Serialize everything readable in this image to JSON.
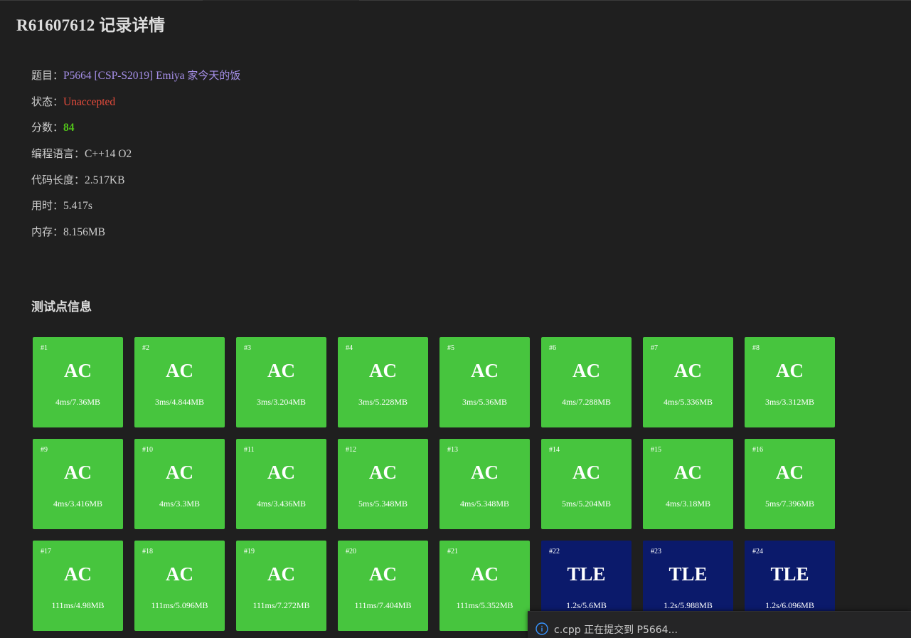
{
  "record": {
    "title": "R61607612 记录详情"
  },
  "info": {
    "problem_label": "题目：",
    "problem_code": "P5664 [CSP-S2019] Emiya ",
    "problem_name_cjk": "家今天的饭",
    "status_label": "状态：",
    "status_value": "Unaccepted",
    "score_label": "分数：",
    "score_value": "84",
    "language_label": "编程语言：",
    "language_value": "C++14 O2",
    "code_length_label": "代码长度：",
    "code_length_value": "2.517KB",
    "time_label": "用时：",
    "time_value": "5.417s",
    "memory_label": "内存：",
    "memory_value": "8.156MB"
  },
  "testcases": {
    "title": "测试点信息",
    "colors": {
      "AC": "#47c53e",
      "TLE": "#0b1a6b"
    },
    "items": [
      {
        "id": "#1",
        "status": "AC",
        "detail": "4ms/7.36MB"
      },
      {
        "id": "#2",
        "status": "AC",
        "detail": "3ms/4.844MB"
      },
      {
        "id": "#3",
        "status": "AC",
        "detail": "3ms/3.204MB"
      },
      {
        "id": "#4",
        "status": "AC",
        "detail": "3ms/5.228MB"
      },
      {
        "id": "#5",
        "status": "AC",
        "detail": "3ms/5.36MB"
      },
      {
        "id": "#6",
        "status": "AC",
        "detail": "4ms/7.288MB"
      },
      {
        "id": "#7",
        "status": "AC",
        "detail": "4ms/5.336MB"
      },
      {
        "id": "#8",
        "status": "AC",
        "detail": "3ms/3.312MB"
      },
      {
        "id": "#9",
        "status": "AC",
        "detail": "4ms/3.416MB"
      },
      {
        "id": "#10",
        "status": "AC",
        "detail": "4ms/3.3MB"
      },
      {
        "id": "#11",
        "status": "AC",
        "detail": "4ms/3.436MB"
      },
      {
        "id": "#12",
        "status": "AC",
        "detail": "5ms/5.348MB"
      },
      {
        "id": "#13",
        "status": "AC",
        "detail": "4ms/5.348MB"
      },
      {
        "id": "#14",
        "status": "AC",
        "detail": "5ms/5.204MB"
      },
      {
        "id": "#15",
        "status": "AC",
        "detail": "4ms/3.18MB"
      },
      {
        "id": "#16",
        "status": "AC",
        "detail": "5ms/7.396MB"
      },
      {
        "id": "#17",
        "status": "AC",
        "detail": "111ms/4.98MB"
      },
      {
        "id": "#18",
        "status": "AC",
        "detail": "111ms/5.096MB"
      },
      {
        "id": "#19",
        "status": "AC",
        "detail": "111ms/7.272MB"
      },
      {
        "id": "#20",
        "status": "AC",
        "detail": "111ms/7.404MB"
      },
      {
        "id": "#21",
        "status": "AC",
        "detail": "111ms/5.352MB"
      },
      {
        "id": "#22",
        "status": "TLE",
        "detail": "1.2s/5.6MB"
      },
      {
        "id": "#23",
        "status": "TLE",
        "detail": "1.2s/5.988MB"
      },
      {
        "id": "#24",
        "status": "TLE",
        "detail": "1.2s/6.096MB"
      }
    ]
  },
  "notification": {
    "icon": "info-icon",
    "text": "c.cpp 正在提交到 P5664..."
  }
}
